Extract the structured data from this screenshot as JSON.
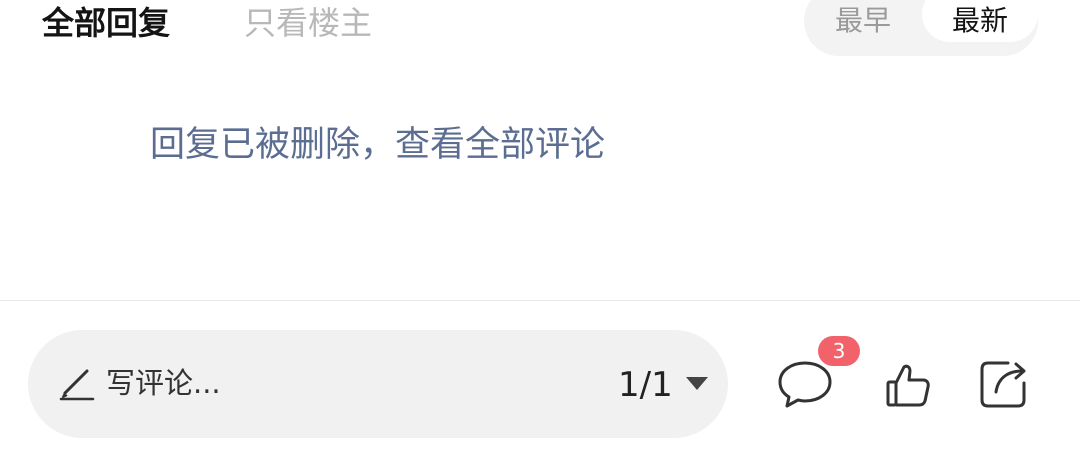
{
  "header": {
    "tab_all_replies": "全部回复",
    "tab_op_only": "只看楼主"
  },
  "sort": {
    "earliest": "最早",
    "latest": "最新",
    "selected": "最新"
  },
  "notice": {
    "text": "回复已被删除，查看全部评论"
  },
  "comment_bar": {
    "placeholder": "写评论...",
    "page_indicator": "1/1"
  },
  "actions": {
    "comment_count": "3"
  },
  "icons": {
    "compose": "pencil-icon",
    "page_dropdown": "triangle-down-icon",
    "comments": "speech-bubble-icon",
    "like": "thumbs-up-icon",
    "share": "share-arrow-icon"
  },
  "colors": {
    "link": "#5b6e92",
    "badge": "#f2626a",
    "input_background": "#f1f1f1"
  }
}
